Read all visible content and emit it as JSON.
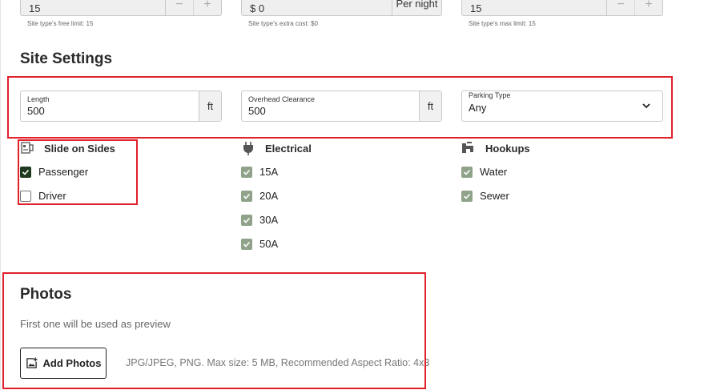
{
  "top_row": {
    "free_limit": {
      "value": "15",
      "hint": "Site type's free limit: 15",
      "minus": "−",
      "plus": "+"
    },
    "extra_cost": {
      "value": "$ 0",
      "suffix": "Per night",
      "hint": "Site type's extra cost: $0"
    },
    "max_limit": {
      "value": "15",
      "hint": "Site type's max limit: 15",
      "minus": "−",
      "plus": "+"
    }
  },
  "site_settings": {
    "title": "Site Settings",
    "length": {
      "label": "Length",
      "value": "500",
      "unit": "ft"
    },
    "clearance": {
      "label": "Overhead Clearance",
      "value": "500",
      "unit": "ft"
    },
    "parking": {
      "label": "Parking Type",
      "value": "Any"
    }
  },
  "slide_on_sides": {
    "title": "Slide on Sides",
    "icon": "slide-out-icon",
    "options": [
      {
        "label": "Passenger",
        "checked": true
      },
      {
        "label": "Driver",
        "checked": false
      }
    ]
  },
  "electrical": {
    "title": "Electrical",
    "icon": "plug-icon",
    "options": [
      {
        "label": "15A",
        "checked": true
      },
      {
        "label": "20A",
        "checked": true
      },
      {
        "label": "30A",
        "checked": true
      },
      {
        "label": "50A",
        "checked": true
      }
    ]
  },
  "hookups": {
    "title": "Hookups",
    "icon": "faucet-icon",
    "options": [
      {
        "label": "Water",
        "checked": true
      },
      {
        "label": "Sewer",
        "checked": true
      }
    ]
  },
  "photos": {
    "title": "Photos",
    "subtitle": "First one will be used as preview",
    "add_button": "Add Photos",
    "note": "JPG/JPEG, PNG. Max size: 5 MB, Recommended Aspect Ratio: 4x3"
  },
  "colors": {
    "highlight": "#e0202a",
    "check_dark": "#1f3a1f",
    "check_muted": "#8fa28a"
  }
}
